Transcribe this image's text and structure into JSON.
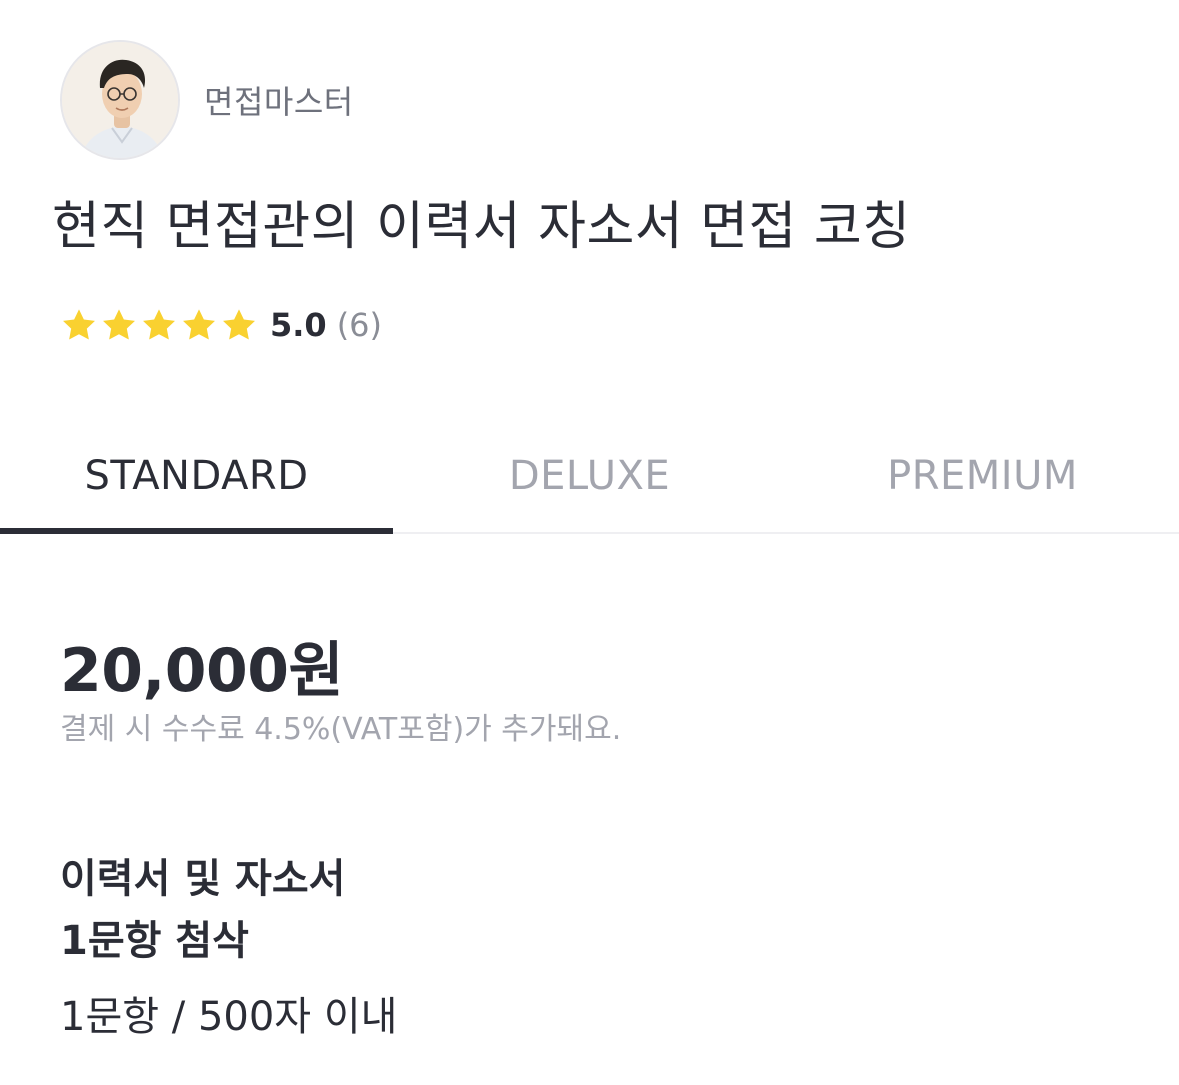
{
  "seller": {
    "name": "면접마스터",
    "avatar_icon": "person-avatar-illustration"
  },
  "service": {
    "title": "현직 면접관의 이력서 자소서 면접 코칭"
  },
  "rating": {
    "stars": 5,
    "score": "5.0",
    "count": "(6)",
    "star_color": "#F9D130"
  },
  "tabs": [
    {
      "label": "STANDARD",
      "active": true
    },
    {
      "label": "DELUXE",
      "active": false
    },
    {
      "label": "PREMIUM",
      "active": false
    }
  ],
  "package": {
    "price": "20,000원",
    "fee_note": "결제 시 수수료 4.5%(VAT포함)가 추가돼요.",
    "title_line1": "이력서 및 자소서",
    "title_line2": "1문항 첨삭",
    "subtitle": "1문항 / 500자 이내"
  },
  "colors": {
    "text_primary": "#2B2D36",
    "text_muted": "#A3A5AE",
    "accent_underline": "#2B2D36"
  }
}
